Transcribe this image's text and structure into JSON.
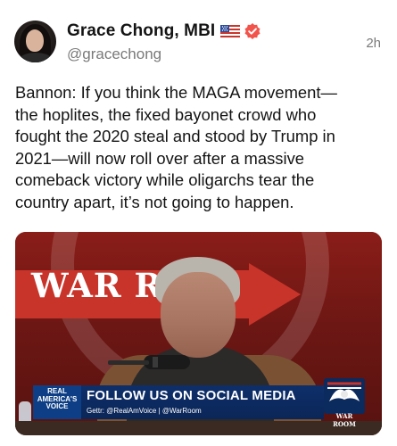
{
  "post": {
    "display_name": "Grace Chong, MBI",
    "flag_icon": "us-flag-icon",
    "verified_icon": "verified-badge-icon",
    "verified_color": "#f2544b",
    "handle": "@gracechong",
    "timestamp": "2h",
    "text": "Bannon: If you think the MAGA movement—\nthe hoplites, the fixed bayonet crowd who\nfought the 2020 steal and stood by Trump in\n2021—will now roll over after a massive\ncomeback victory while oligarchs tear the\ncountry apart, it’s not going to happen."
  },
  "media": {
    "sign_text": "WAR R",
    "lower_third": {
      "logo_text": "REAL AMERICA'S VOICE",
      "title": "FOLLOW US ON SOCIAL MEDIA",
      "subtitle": "Gettr: @RealAmVoice | @WarRoom",
      "brand_label": "WAR ROOM"
    },
    "colors": {
      "sign_red": "#c8342a",
      "lower_third_blue": "#0e2f6b"
    }
  }
}
